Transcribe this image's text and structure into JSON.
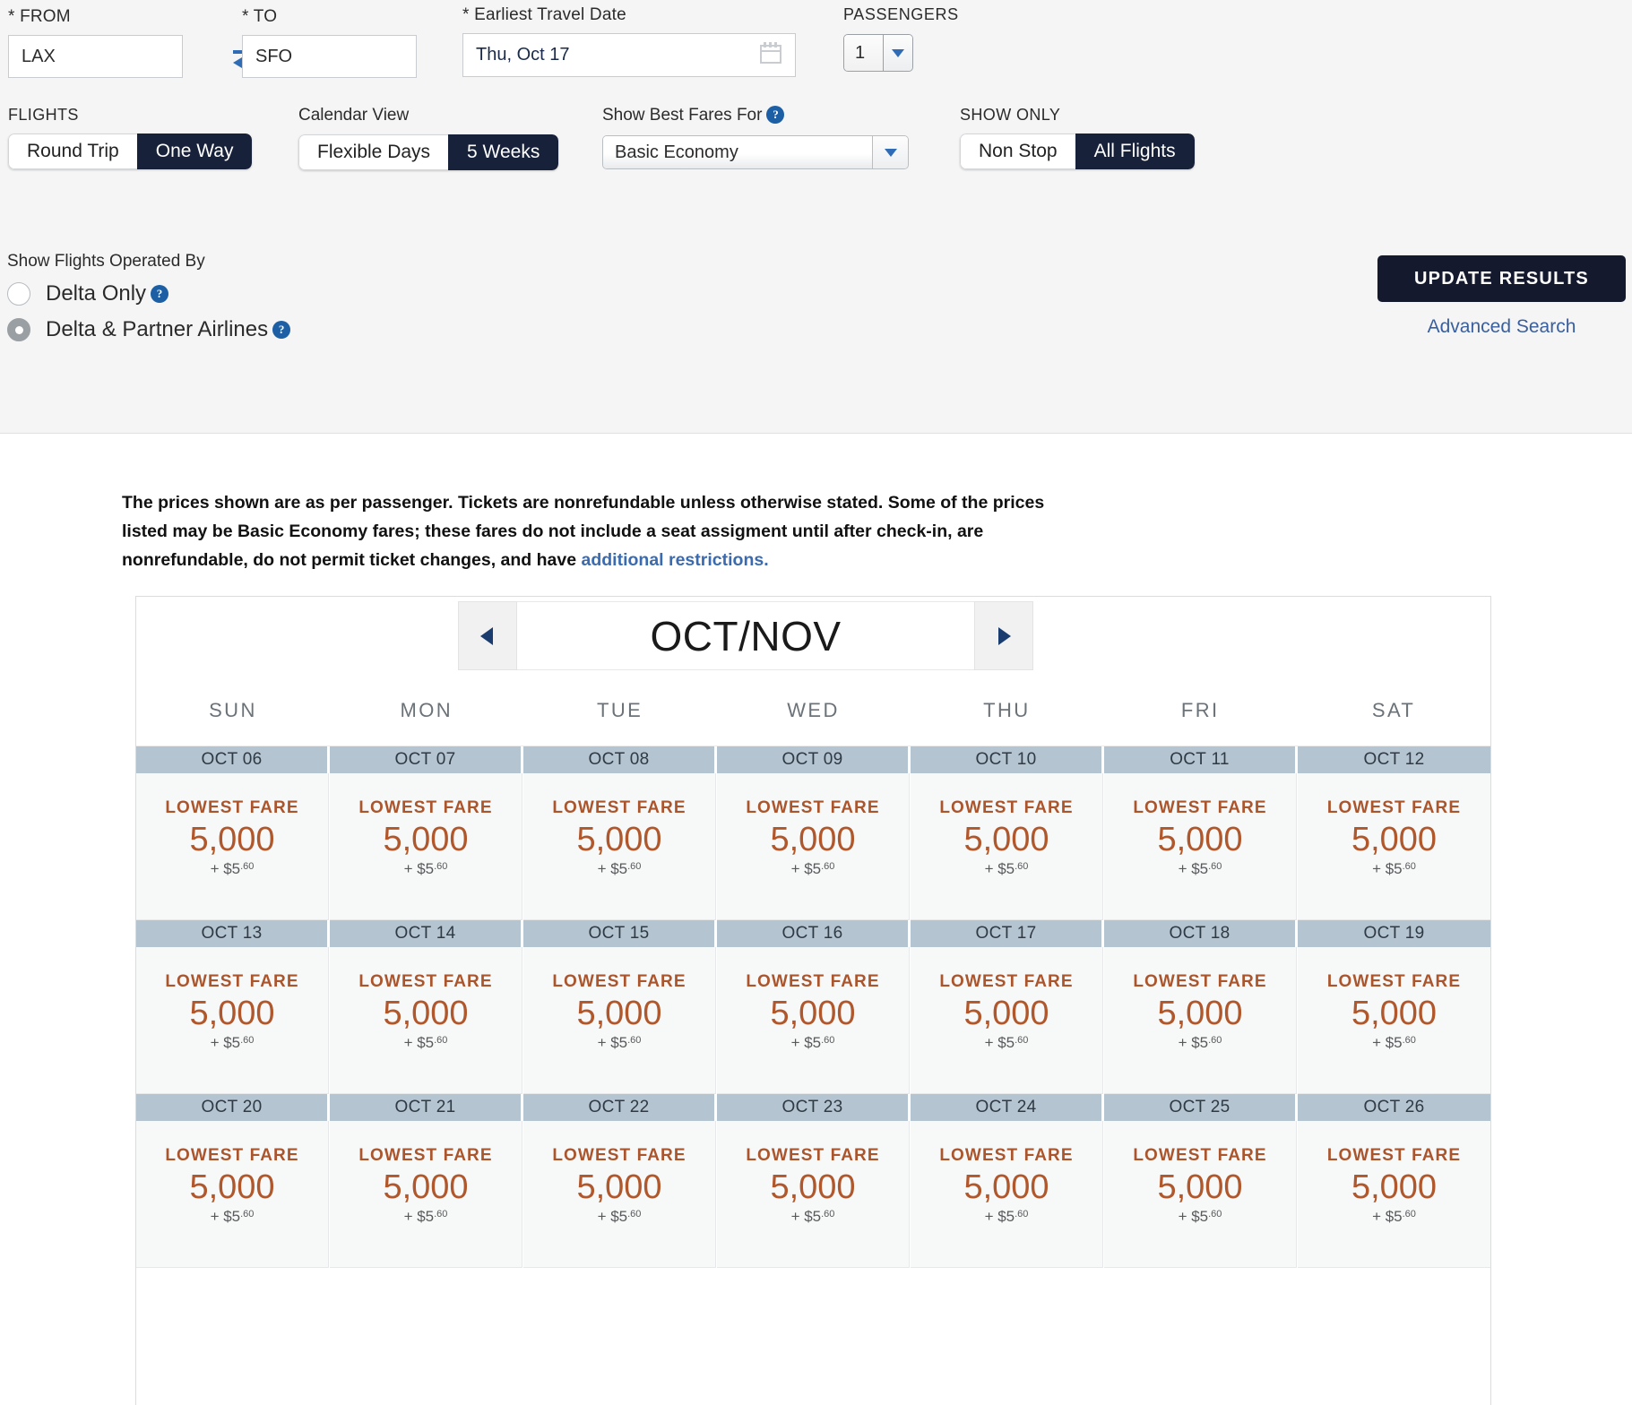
{
  "search": {
    "from": {
      "label": "* FROM",
      "value": "LAX"
    },
    "to": {
      "label": "* TO",
      "value": "SFO"
    },
    "swap_icon": "swap-arrows-icon",
    "date": {
      "label": "* Earliest Travel Date",
      "value": "Thu, Oct 17",
      "icon": "calendar-icon"
    },
    "passengers": {
      "label": "PASSENGERS",
      "value": "1"
    },
    "flights": {
      "label": "FLIGHTS",
      "options": [
        "Round Trip",
        "One Way"
      ],
      "selected": "One Way"
    },
    "calendar_view": {
      "label": "Calendar View",
      "options": [
        "Flexible Days",
        "5 Weeks"
      ],
      "selected": "5 Weeks"
    },
    "best_fares": {
      "label": "Show Best Fares For",
      "value": "Basic Economy",
      "help_icon": "help-icon"
    },
    "show_only": {
      "label": "SHOW ONLY",
      "options": [
        "Non Stop",
        "All Flights"
      ],
      "selected": "All Flights"
    },
    "operated_by": {
      "label": "Show Flights Operated By",
      "options": [
        {
          "label": "Delta Only",
          "checked": false
        },
        {
          "label": "Delta & Partner Airlines",
          "checked": true
        }
      ]
    },
    "update_button": "UPDATE RESULTS",
    "advanced_search": "Advanced Search"
  },
  "disclaimer": {
    "text": "The prices shown are as per passenger. Tickets are nonrefundable unless otherwise stated. Some of the prices listed may be Basic Economy fares; these fares do not include a seat assigment until after check-in, are nonrefundable, do not permit ticket changes, and have ",
    "link": "additional restrictions."
  },
  "calendar": {
    "title": "OCT/NOV",
    "prev_icon": "chevron-left-icon",
    "next_icon": "chevron-right-icon",
    "day_headers": [
      "SUN",
      "MON",
      "TUE",
      "WED",
      "THU",
      "FRI",
      "SAT"
    ],
    "fare_label": "LOWEST FARE",
    "weeks": [
      {
        "days": [
          {
            "date": "OCT 06",
            "fare_label": "LOWEST FARE",
            "miles": "5,000",
            "taxes_prefix": "+ $5",
            "taxes_cents": ".60"
          },
          {
            "date": "OCT 07",
            "fare_label": "LOWEST FARE",
            "miles": "5,000",
            "taxes_prefix": "+ $5",
            "taxes_cents": ".60"
          },
          {
            "date": "OCT 08",
            "fare_label": "LOWEST FARE",
            "miles": "5,000",
            "taxes_prefix": "+ $5",
            "taxes_cents": ".60"
          },
          {
            "date": "OCT 09",
            "fare_label": "LOWEST FARE",
            "miles": "5,000",
            "taxes_prefix": "+ $5",
            "taxes_cents": ".60"
          },
          {
            "date": "OCT 10",
            "fare_label": "LOWEST FARE",
            "miles": "5,000",
            "taxes_prefix": "+ $5",
            "taxes_cents": ".60"
          },
          {
            "date": "OCT 11",
            "fare_label": "LOWEST FARE",
            "miles": "5,000",
            "taxes_prefix": "+ $5",
            "taxes_cents": ".60"
          },
          {
            "date": "OCT 12",
            "fare_label": "LOWEST FARE",
            "miles": "5,000",
            "taxes_prefix": "+ $5",
            "taxes_cents": ".60"
          }
        ]
      },
      {
        "days": [
          {
            "date": "OCT 13",
            "fare_label": "LOWEST FARE",
            "miles": "5,000",
            "taxes_prefix": "+ $5",
            "taxes_cents": ".60"
          },
          {
            "date": "OCT 14",
            "fare_label": "LOWEST FARE",
            "miles": "5,000",
            "taxes_prefix": "+ $5",
            "taxes_cents": ".60"
          },
          {
            "date": "OCT 15",
            "fare_label": "LOWEST FARE",
            "miles": "5,000",
            "taxes_prefix": "+ $5",
            "taxes_cents": ".60"
          },
          {
            "date": "OCT 16",
            "fare_label": "LOWEST FARE",
            "miles": "5,000",
            "taxes_prefix": "+ $5",
            "taxes_cents": ".60"
          },
          {
            "date": "OCT 17",
            "fare_label": "LOWEST FARE",
            "miles": "5,000",
            "taxes_prefix": "+ $5",
            "taxes_cents": ".60"
          },
          {
            "date": "OCT 18",
            "fare_label": "LOWEST FARE",
            "miles": "5,000",
            "taxes_prefix": "+ $5",
            "taxes_cents": ".60"
          },
          {
            "date": "OCT 19",
            "fare_label": "LOWEST FARE",
            "miles": "5,000",
            "taxes_prefix": "+ $5",
            "taxes_cents": ".60"
          }
        ]
      },
      {
        "days": [
          {
            "date": "OCT 20",
            "fare_label": "LOWEST FARE",
            "miles": "5,000",
            "taxes_prefix": "+ $5",
            "taxes_cents": ".60"
          },
          {
            "date": "OCT 21",
            "fare_label": "LOWEST FARE",
            "miles": "5,000",
            "taxes_prefix": "+ $5",
            "taxes_cents": ".60"
          },
          {
            "date": "OCT 22",
            "fare_label": "LOWEST FARE",
            "miles": "5,000",
            "taxes_prefix": "+ $5",
            "taxes_cents": ".60"
          },
          {
            "date": "OCT 23",
            "fare_label": "LOWEST FARE",
            "miles": "5,000",
            "taxes_prefix": "+ $5",
            "taxes_cents": ".60"
          },
          {
            "date": "OCT 24",
            "fare_label": "LOWEST FARE",
            "miles": "5,000",
            "taxes_prefix": "+ $5",
            "taxes_cents": ".60"
          },
          {
            "date": "OCT 25",
            "fare_label": "LOWEST FARE",
            "miles": "5,000",
            "taxes_prefix": "+ $5",
            "taxes_cents": ".60"
          },
          {
            "date": "OCT 26",
            "fare_label": "LOWEST FARE",
            "miles": "5,000",
            "taxes_prefix": "+ $5",
            "taxes_cents": ".60"
          }
        ]
      }
    ]
  },
  "colors": {
    "accent_dark": "#14192e",
    "link_blue": "#3a5f9e",
    "fare_orange": "#b0572c",
    "date_band": "#b4c4d1",
    "panel_bg": "#f5f5f5"
  }
}
